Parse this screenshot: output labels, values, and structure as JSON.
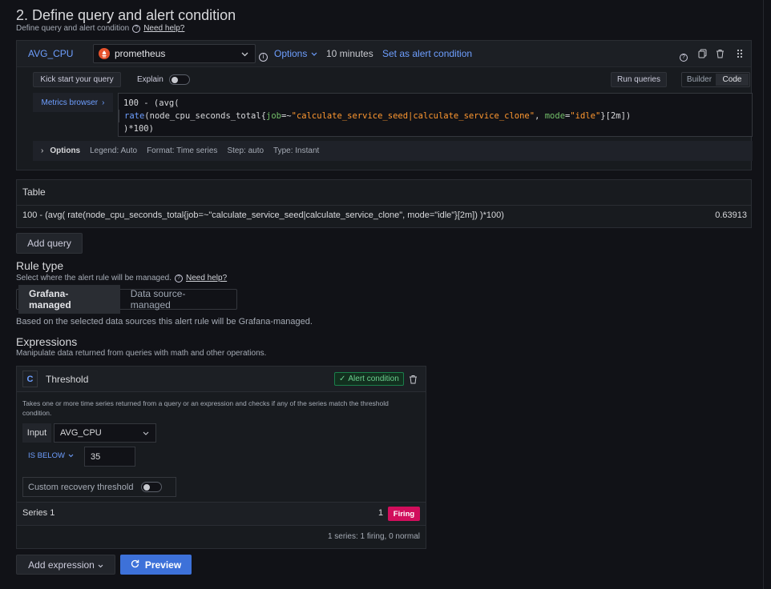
{
  "section": {
    "title": "2. Define query and alert condition",
    "subtitle": "Define query and alert condition",
    "help": "Need help?"
  },
  "query": {
    "ref": "AVG_CPU",
    "datasource": "prometheus",
    "options_label": "Options",
    "interval": "10 minutes",
    "set_alert": "Set as alert condition",
    "kickstart": "Kick start your query",
    "explain": "Explain",
    "run_queries": "Run queries",
    "mode_builder": "Builder",
    "mode_code": "Code",
    "metrics_browser": "Metrics browser",
    "code_line1": "100 - (avg(",
    "code_l2_fn": "rate",
    "code_l2_metric": "(node_cpu_seconds_total{",
    "code_l2_k1": "job",
    "code_l2_op1": "=~",
    "code_l2_v1": "\"calculate_service_seed|calculate_service_clone\"",
    "code_l2_sep": ", ",
    "code_l2_k2": "mode",
    "code_l2_op2": "=",
    "code_l2_v2": "\"idle\"",
    "code_l2_tail": "}[2m])",
    "code_line3": ")*100)",
    "opts_label": "Options",
    "legend": "Legend: Auto",
    "format": "Format: Time series",
    "step": "Step: auto",
    "type": "Type: Instant"
  },
  "table": {
    "title": "Table",
    "expr": "100 - (avg( rate(node_cpu_seconds_total{job=~\"calculate_service_seed|calculate_service_clone\", mode=\"idle\"}[2m]) )*100)",
    "value": "0.63913"
  },
  "add_query": "Add query",
  "rule_type": {
    "title": "Rule type",
    "subtitle": "Select where the alert rule will be managed.",
    "help": "Need help?",
    "tab_grafana": "Grafana-managed",
    "tab_datasource": "Data source-managed",
    "note": "Based on the selected data sources this alert rule will be Grafana-managed."
  },
  "expressions": {
    "title": "Expressions",
    "subtitle": "Manipulate data returned from queries with math and other operations.",
    "card_ref": "C",
    "card_name": "Threshold",
    "alert_badge": "Alert condition",
    "description": "Takes one or more time series returned from a query or an expression and checks if any of the series match the threshold condition.",
    "input_label": "Input",
    "input_value": "AVG_CPU",
    "condition": "IS BELOW",
    "threshold": "35",
    "recovery": "Custom recovery threshold",
    "series_name": "Series 1",
    "series_value": "1",
    "firing": "Firing",
    "summary": "1 series: 1 firing, 0 normal"
  },
  "footer": {
    "add_expression": "Add expression",
    "preview": "Preview"
  },
  "colors": {
    "accent": "#6e9fff",
    "primary": "#3d71d9",
    "firing": "#d10e5c",
    "success": "#1a7f4b",
    "background": "#111217"
  },
  "icons": [
    "question-icon",
    "chevron-down-icon",
    "info-icon",
    "copy-icon",
    "trash-icon",
    "drag-handle-icon",
    "chevron-right-icon",
    "check-icon",
    "refresh-icon"
  ]
}
